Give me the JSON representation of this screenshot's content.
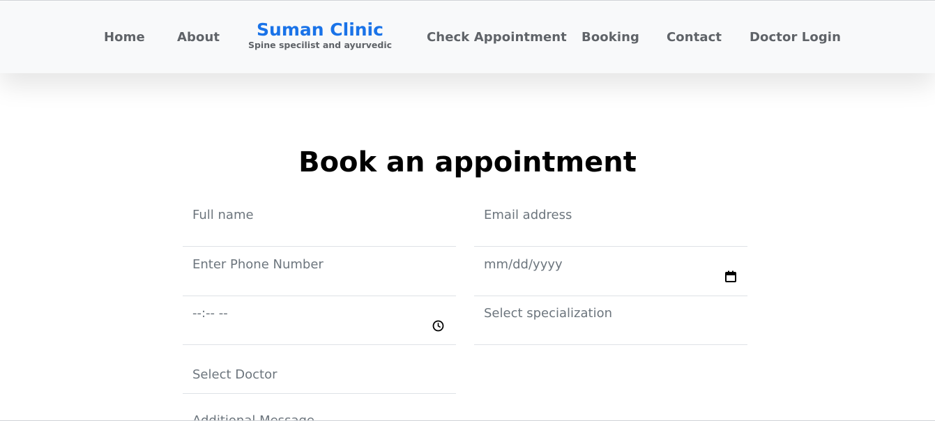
{
  "nav": {
    "home": "Home",
    "about": "About",
    "brand_name": "Suman Clinic",
    "brand_tagline": "Spine specilist and ayurvedic",
    "check_appointment": "Check Appointment",
    "booking": "Booking",
    "contact": "Contact",
    "doctor_login": "Doctor Login"
  },
  "form": {
    "heading": "Book an appointment",
    "full_name_placeholder": "Full name",
    "email_placeholder": "Email address",
    "phone_placeholder": "Enter Phone Number",
    "date_placeholder": "mm/dd/yyyy",
    "time_placeholder": "--:-- --",
    "specialization_placeholder": "Select specialization",
    "doctor_placeholder": "Select Doctor",
    "message_placeholder": "Additional Message"
  },
  "icons": {
    "date": "calendar-icon",
    "time": "clock-icon"
  },
  "colors": {
    "brand": "#1a73e8",
    "nav_text": "#5f6368",
    "placeholder": "#6c757d",
    "navbar_bg": "#f8f9fa"
  }
}
